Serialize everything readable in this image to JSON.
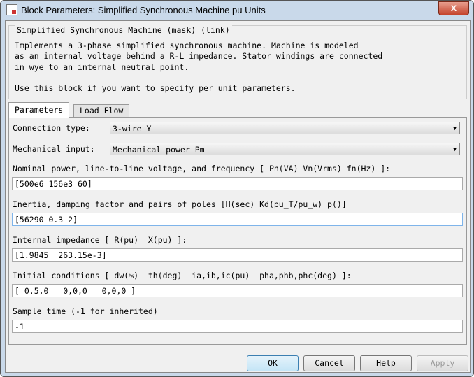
{
  "window": {
    "title": "Block Parameters: Simplified Synchronous Machine pu Units",
    "close": "X"
  },
  "description": {
    "header": "Simplified Synchronous Machine (mask) (link)",
    "text": "Implements a 3-phase simplified synchronous machine. Machine is modeled\nas an internal voltage behind a R-L impedance. Stator windings are connected\nin wye to an internal neutral point.\n\nUse this block if you want to specify per unit parameters."
  },
  "tabs": [
    {
      "label": "Parameters",
      "active": true
    },
    {
      "label": "Load Flow",
      "active": false
    }
  ],
  "params": {
    "connection_type": {
      "label": "Connection type:",
      "value": "3-wire Y"
    },
    "mechanical_input": {
      "label": "Mechanical input:",
      "value": "Mechanical power Pm"
    },
    "fields": [
      {
        "label": "Nominal power, line-to-line voltage, and frequency [ Pn(VA) Vn(Vrms) fn(Hz) ]:",
        "value": "[500e6 156e3 60]"
      },
      {
        "label": "Inertia, damping factor and pairs of poles [H(sec) Kd(pu_T/pu_w) p()]",
        "value": "[56290 0.3 2]"
      },
      {
        "label": "Internal impedance [ R(pu)  X(pu) ]:",
        "value": "[1.9845  263.15e-3]"
      },
      {
        "label": "Initial conditions [ dw(%)  th(deg)  ia,ib,ic(pu)  pha,phb,phc(deg) ]:",
        "value": "[ 0.5,0   0,0,0   0,0,0 ]"
      },
      {
        "label": "Sample time (-1 for inherited)",
        "value": "-1"
      }
    ]
  },
  "buttons": {
    "ok": "OK",
    "cancel": "Cancel",
    "help": "Help",
    "apply": "Apply"
  }
}
